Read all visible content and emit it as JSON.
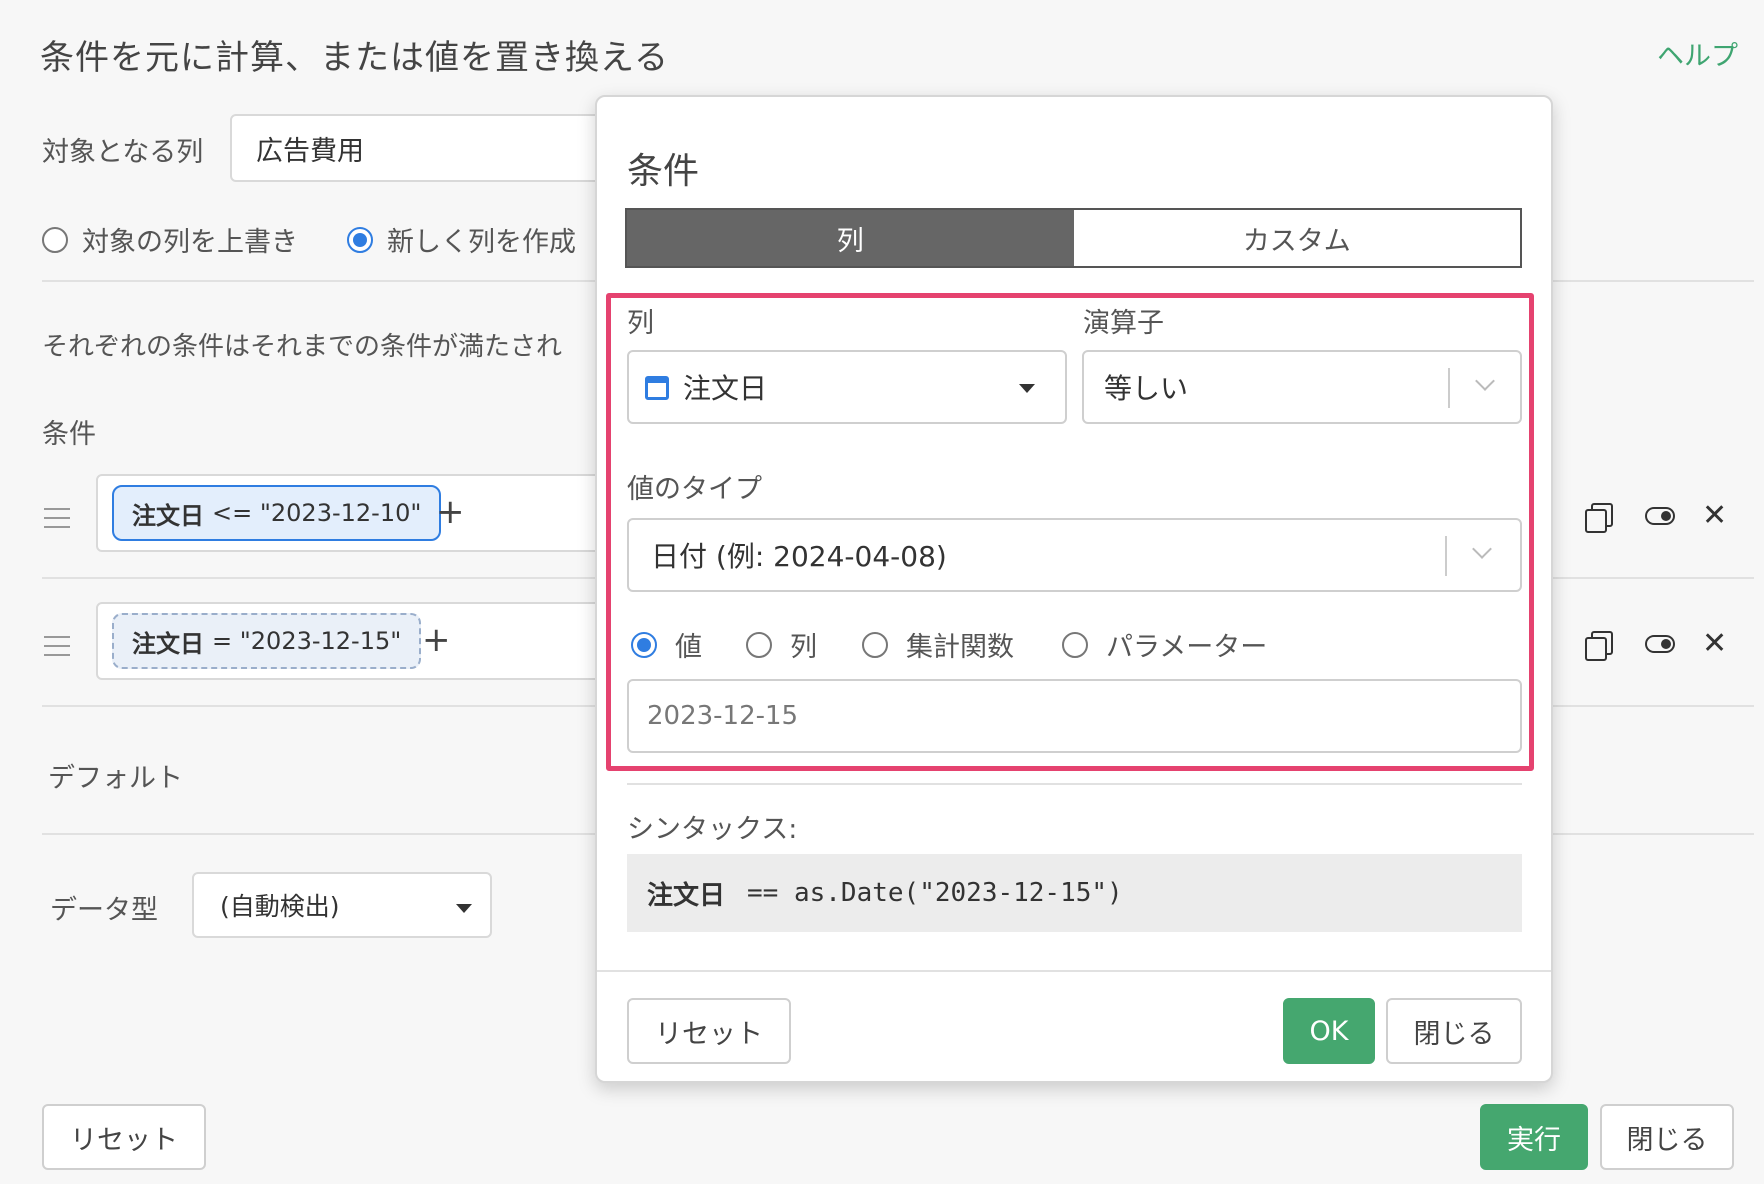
{
  "page": {
    "title": "条件を元に計算、または値を置き換える",
    "help": "ヘルプ",
    "target_col_label": "対象となる列",
    "target_col_value": "広告費用",
    "radio_overwrite": "対象の列を上書き",
    "radio_new": "新しく列を作成",
    "description": "それぞれの条件はそれまでの条件が満たされ",
    "conditions_label": "条件",
    "conditions": [
      {
        "col": "注文日",
        "op_value": "<= \"2023-12-10\""
      },
      {
        "col": "注文日",
        "op_value": "= \"2023-12-15\""
      }
    ],
    "plus": "+",
    "default_label": "デフォルト",
    "datatype_label": "データ型",
    "datatype_value": "(自動検出)",
    "reset": "リセット",
    "run": "実行",
    "close": "閉じる"
  },
  "modal": {
    "title": "条件",
    "tabs": [
      "列",
      "カスタム"
    ],
    "column_label": "列",
    "column_value": "注文日",
    "operator_label": "演算子",
    "operator_value": "等しい",
    "value_type_label": "値のタイプ",
    "value_type_value": "日付 (例: 2024-04-08)",
    "value_options": [
      "値",
      "列",
      "集計関数",
      "パラメーター"
    ],
    "value_input": "2023-12-15",
    "syntax_label": "シンタックス:",
    "syntax_col": "注文日",
    "syntax_expr": "== as.Date(\"2023-12-15\")",
    "reset": "リセット",
    "ok": "OK",
    "close": "閉じる"
  },
  "colors": {
    "accent_green": "#45a76f",
    "highlight": "#e5426f",
    "radio_blue": "#2f7de1"
  }
}
